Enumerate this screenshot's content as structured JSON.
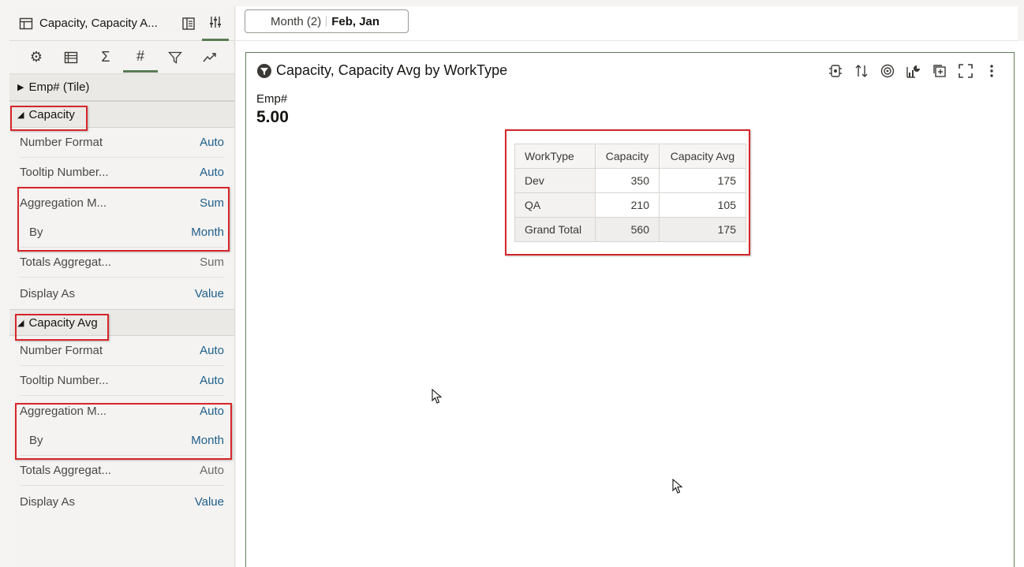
{
  "left_panel": {
    "tab_title": "Capacity, Capacity A...",
    "sections": {
      "emp_tile": {
        "label": "Emp# (Tile)"
      },
      "capacity": {
        "label": "Capacity",
        "props": [
          {
            "key": "Number Format",
            "value": "Auto"
          },
          {
            "key": "Tooltip Number...",
            "value": "Auto"
          },
          {
            "key": "Aggregation M...",
            "value": "Sum"
          },
          {
            "key": "By",
            "value": "Month"
          },
          {
            "key": "Totals Aggregat...",
            "value": "Sum"
          },
          {
            "key": "Display As",
            "value": "Value"
          }
        ]
      },
      "capacity_avg": {
        "label": "Capacity Avg",
        "props": [
          {
            "key": "Number Format",
            "value": "Auto"
          },
          {
            "key": "Tooltip Number...",
            "value": "Auto"
          },
          {
            "key": "Aggregation M...",
            "value": "Auto"
          },
          {
            "key": "By",
            "value": "Month"
          },
          {
            "key": "Totals Aggregat...",
            "value": "Auto"
          },
          {
            "key": "Display As",
            "value": "Value"
          }
        ]
      }
    }
  },
  "filter": {
    "label": "Month (2)",
    "value": "Feb, Jan"
  },
  "viz": {
    "title": "Capacity, Capacity Avg by WorkType",
    "tile_label": "Emp#",
    "tile_value": "5.00",
    "table": {
      "headers": [
        "WorkType",
        "Capacity",
        "Capacity Avg"
      ],
      "rows": [
        [
          "Dev",
          "350",
          "175"
        ],
        [
          "QA",
          "210",
          "105"
        ],
        [
          "Grand Total",
          "560",
          "175"
        ]
      ]
    }
  },
  "colors": {
    "accent_green": "#5a7b53",
    "link_blue": "#1f5f8b",
    "highlight_red": "#d6262b"
  }
}
